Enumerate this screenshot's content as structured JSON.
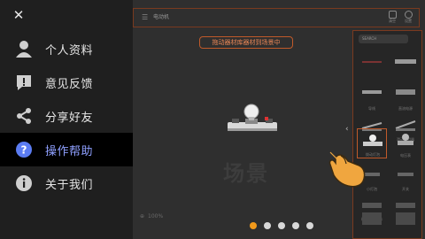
{
  "menu": {
    "close_icon": "close-icon",
    "items": [
      {
        "label": "个人资料",
        "icon": "user-icon"
      },
      {
        "label": "意见反馈",
        "icon": "feedback-icon"
      },
      {
        "label": "分享好友",
        "icon": "share-icon"
      },
      {
        "label": "操作帮助",
        "icon": "help-icon",
        "active": true
      },
      {
        "label": "关于我们",
        "icon": "info-icon"
      }
    ]
  },
  "toolbar": {
    "title": "电动机",
    "buttons": [
      {
        "label": "清空"
      },
      {
        "label": "设置"
      }
    ]
  },
  "hint": "拖动器材库器材到场景中",
  "panel": {
    "search_placeholder": "SEARCH",
    "items": [
      {
        "label": ""
      },
      {
        "label": ""
      },
      {
        "label": "导线"
      },
      {
        "label": "直流电源"
      },
      {
        "label": ""
      },
      {
        "label": "滑动变阻器"
      },
      {
        "label": "电流表"
      },
      {
        "label": "电压表"
      },
      {
        "label": "小灯泡"
      },
      {
        "label": "开关"
      },
      {
        "label": "粗细不同导体"
      },
      {
        "label": "蜂鸣器"
      }
    ]
  },
  "stage": {
    "scene_label": "场景",
    "zoom_label": "100%"
  },
  "selected_item": {
    "label": "拨动灯泡"
  },
  "pagination": {
    "current": 1,
    "total": 5
  },
  "colors": {
    "accent": "#f29a1b",
    "active_text": "#8fa0ff",
    "border": "#7a3a1f",
    "hint": "#e88656"
  }
}
